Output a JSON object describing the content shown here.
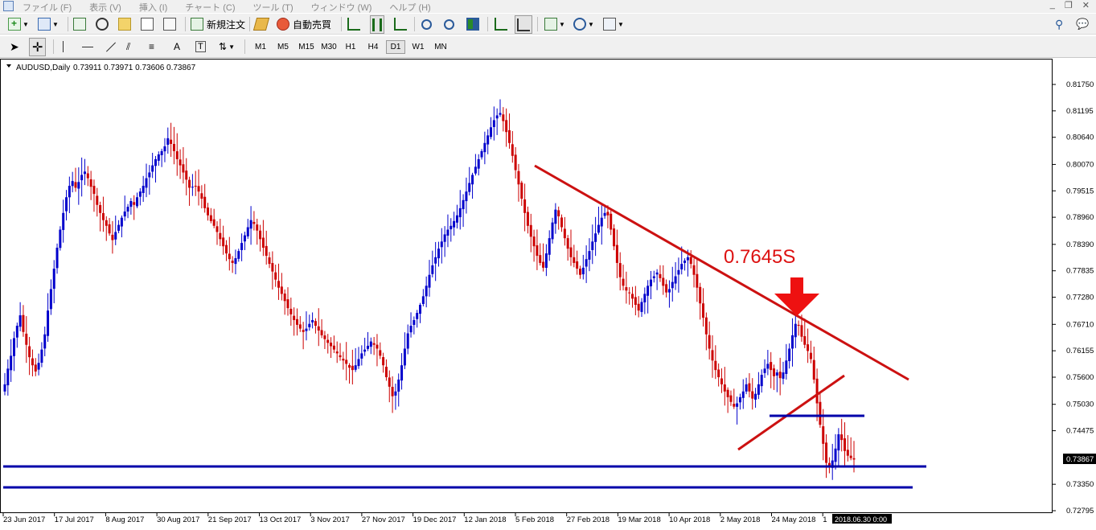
{
  "menubar": {
    "items": [
      "ファイル (F)",
      "表示 (V)",
      "挿入 (I)",
      "チャート (C)",
      "ツール (T)",
      "ウィンドウ (W)",
      "ヘルプ (H)"
    ]
  },
  "toolbar": {
    "new_order_label": "新規注文",
    "auto_trade_label": "自動売買"
  },
  "timeframes": [
    "M1",
    "M5",
    "M15",
    "M30",
    "H1",
    "H4",
    "D1",
    "W1",
    "MN"
  ],
  "active_timeframe": "D1",
  "chart_header": {
    "symbol": "AUDUSD,Daily",
    "ohlc": "0.73911 0.73971 0.73606 0.73867"
  },
  "chart_data": {
    "type": "candlestick",
    "symbol": "AUDUSD",
    "timeframe": "Daily",
    "price_axis": [
      "0.81750",
      "0.81195",
      "0.80640",
      "0.80070",
      "0.79515",
      "0.78960",
      "0.78390",
      "0.77835",
      "0.77280",
      "0.76710",
      "0.76155",
      "0.75600",
      "0.75030",
      "0.74475",
      "0.73867",
      "0.73350",
      "0.72795"
    ],
    "price_axis_values": [
      0.8175,
      0.81195,
      0.8064,
      0.8007,
      0.79515,
      0.7896,
      0.7839,
      0.77835,
      0.7728,
      0.7671,
      0.76155,
      0.756,
      0.7503,
      0.74475,
      0.73867,
      0.7335,
      0.72795
    ],
    "current_price_label": "0.73867",
    "time_axis": [
      "23 Jun 2017",
      "17 Jul 2017",
      "8 Aug 2017",
      "30 Aug 2017",
      "21 Sep 2017",
      "13 Oct 2017",
      "3 Nov 2017",
      "27 Nov 2017",
      "19 Dec 2017",
      "12 Jan 2018",
      "5 Feb 2018",
      "27 Feb 2018",
      "19 Mar 2018",
      "10 Apr 2018",
      "2 May 2018",
      "24 May 2018",
      "1"
    ],
    "crosshair_time_label": "2018.06.30 0:00",
    "annotation": "0.7645S",
    "colors": {
      "bull": "#0000cc",
      "bear": "#cc0000",
      "trendline": "#cc1111",
      "hline": "#0000aa",
      "annotation": "#dd1111"
    },
    "closes": [
      0.7545,
      0.7578,
      0.7605,
      0.7642,
      0.7668,
      0.769,
      0.7655,
      0.7628,
      0.7602,
      0.7585,
      0.7572,
      0.759,
      0.7618,
      0.765,
      0.77,
      0.7745,
      0.7788,
      0.7832,
      0.787,
      0.7905,
      0.7938,
      0.7962,
      0.7972,
      0.7958,
      0.797,
      0.7985,
      0.7992,
      0.7978,
      0.796,
      0.7945,
      0.7922,
      0.7905,
      0.789,
      0.7878,
      0.7862,
      0.7848,
      0.7865,
      0.788,
      0.7895,
      0.7908,
      0.7918,
      0.793,
      0.7922,
      0.7938,
      0.795,
      0.7962,
      0.7978,
      0.799,
      0.8005,
      0.8018,
      0.8028,
      0.8035,
      0.8045,
      0.8062,
      0.805,
      0.8035,
      0.8018,
      0.8005,
      0.799,
      0.7975,
      0.7958,
      0.796,
      0.7962,
      0.795,
      0.7935,
      0.7915,
      0.79,
      0.7888,
      0.7878,
      0.7865,
      0.785,
      0.7835,
      0.782,
      0.7808,
      0.78,
      0.781,
      0.7825,
      0.7842,
      0.7858,
      0.7875,
      0.789,
      0.7882,
      0.7868,
      0.785,
      0.7832,
      0.7815,
      0.7798,
      0.7782,
      0.7765,
      0.7748,
      0.7735,
      0.772,
      0.7705,
      0.7692,
      0.768,
      0.767,
      0.7662,
      0.7655,
      0.7662,
      0.7672,
      0.768,
      0.7668,
      0.7658,
      0.7648,
      0.764,
      0.7632,
      0.7625,
      0.7618,
      0.761,
      0.7602,
      0.7595,
      0.7588,
      0.758,
      0.7575,
      0.7585,
      0.7598,
      0.761,
      0.7618,
      0.7626,
      0.7635,
      0.7628,
      0.762,
      0.7605,
      0.7585,
      0.756,
      0.754,
      0.752,
      0.753,
      0.7555,
      0.7585,
      0.762,
      0.7652,
      0.7668,
      0.768,
      0.7695,
      0.7712,
      0.773,
      0.7752,
      0.7775,
      0.7795,
      0.7812,
      0.783,
      0.7845,
      0.786,
      0.787,
      0.7878,
      0.7888,
      0.79,
      0.7915,
      0.7932,
      0.795,
      0.7968,
      0.7985,
      0.8002,
      0.8018,
      0.8035,
      0.8052,
      0.8068,
      0.8085,
      0.81,
      0.811,
      0.8115,
      0.8098,
      0.8075,
      0.8052,
      0.8025,
      0.7995,
      0.7965,
      0.7935,
      0.7905,
      0.7878,
      0.7855,
      0.7835,
      0.7815,
      0.78,
      0.779,
      0.782,
      0.7852,
      0.7885,
      0.7912,
      0.7898,
      0.7875,
      0.7852,
      0.783,
      0.7812,
      0.78,
      0.7788,
      0.7775,
      0.779,
      0.7808,
      0.7825,
      0.7845,
      0.7862,
      0.788,
      0.7895,
      0.7905,
      0.79,
      0.787,
      0.7835,
      0.78,
      0.777,
      0.7752,
      0.7742,
      0.7738,
      0.7725,
      0.7712,
      0.77,
      0.7718,
      0.7735,
      0.7752,
      0.7765,
      0.7772,
      0.778,
      0.7768,
      0.7752,
      0.7738,
      0.7745,
      0.776,
      0.7772,
      0.7785,
      0.7798,
      0.7805,
      0.7812,
      0.7798,
      0.7775,
      0.7748,
      0.7715,
      0.7685,
      0.765,
      0.762,
      0.7595,
      0.7575,
      0.756,
      0.7545,
      0.753,
      0.7518,
      0.7508,
      0.7498,
      0.7505,
      0.7518,
      0.753,
      0.7545,
      0.753,
      0.7515,
      0.7525,
      0.7545,
      0.7565,
      0.7578,
      0.7588,
      0.7575,
      0.7562,
      0.757,
      0.7558,
      0.757,
      0.7595,
      0.762,
      0.7648,
      0.7672,
      0.7668,
      0.7645,
      0.7628,
      0.7615,
      0.7598,
      0.7555,
      0.7505,
      0.746,
      0.742,
      0.738,
      0.737,
      0.7385,
      0.741,
      0.744,
      0.7428,
      0.7405,
      0.7395,
      0.739,
      0.7387
    ]
  }
}
